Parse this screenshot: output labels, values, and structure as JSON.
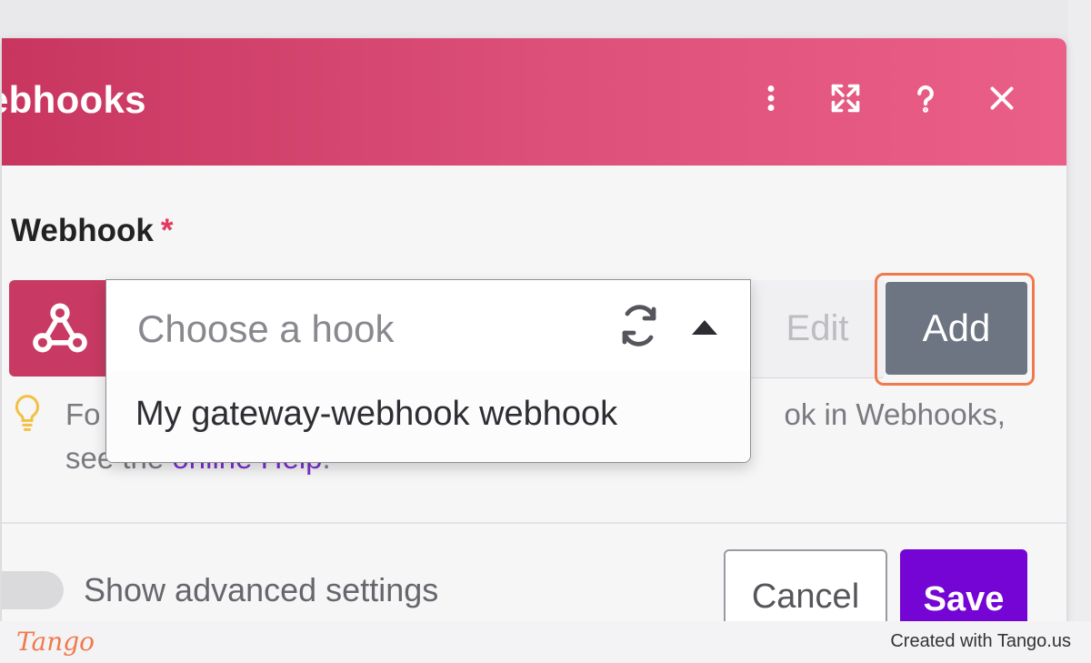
{
  "dialog": {
    "title": "ebhooks",
    "header_icons": [
      "more-vertical-icon",
      "expand-icon",
      "help-icon",
      "close-icon"
    ],
    "field_label": "Webhook",
    "required_marker": "*",
    "dropdown": {
      "placeholder": "Choose a hook",
      "options": [
        "My gateway-webhook webhook"
      ]
    },
    "edit_label": "Edit",
    "add_label": "Add",
    "help_text_left": "Fo",
    "help_text_right": "ok in Webhooks,",
    "help_text_line2_prefix": "see the ",
    "help_link": "online Help",
    "help_text_line2_suffix": ".",
    "advanced_toggle_label": "Show advanced settings",
    "cancel_label": "Cancel",
    "save_label": "Save"
  },
  "footer": {
    "logo": "Tango",
    "credit": "Created with Tango.us"
  },
  "colors": {
    "header_start": "#c8365f",
    "header_end": "#ea5f88",
    "add_button": "#6c7581",
    "save_button": "#7405d4",
    "highlight": "#f07a4b",
    "link": "#7b2fd0"
  }
}
